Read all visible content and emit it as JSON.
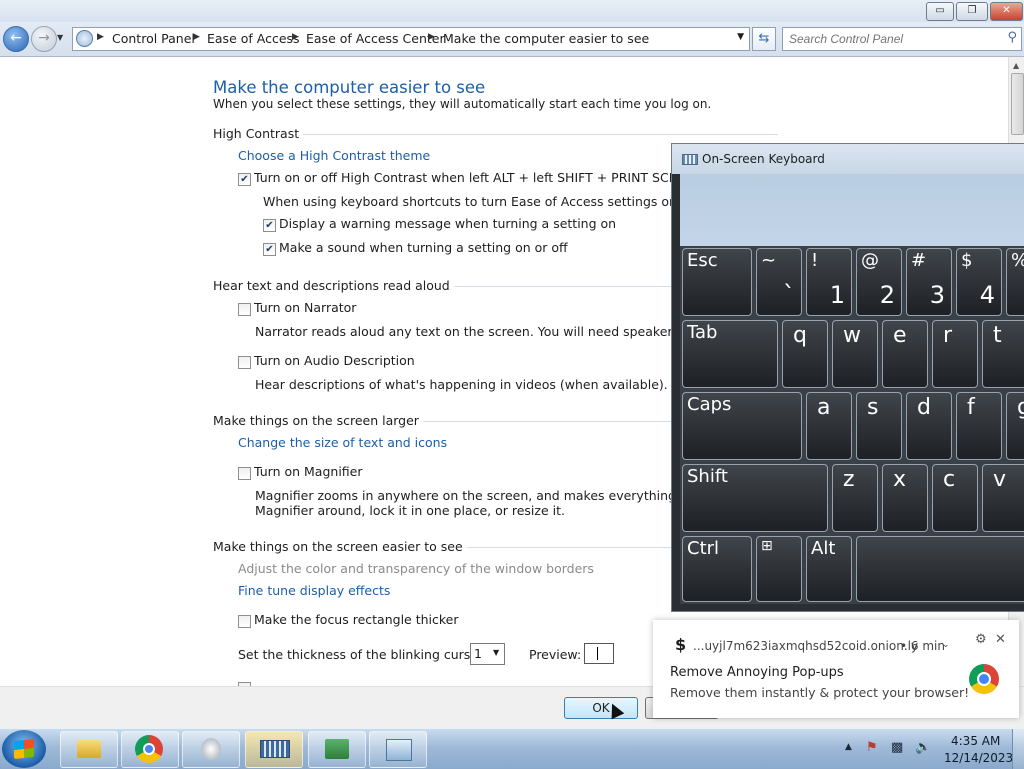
{
  "window": {
    "minimize": "▭",
    "restore": "❐",
    "close": "✕"
  },
  "address": {
    "crumbs": [
      "Control Panel",
      "Ease of Access",
      "Ease of Access Center",
      "Make the computer easier to see"
    ],
    "search_placeholder": "Search Control Panel"
  },
  "page": {
    "title": "Make the computer easier to see",
    "subtitle": "When you select these settings, they will automatically start each time you log on.",
    "high_contrast": {
      "heading": "High Contrast",
      "link": "Choose a High Contrast theme",
      "toggle_label": "Turn on or off High Contrast when left ALT + left SHIFT + PRINT SCREEN is p",
      "toggle_checked": true,
      "shortcut_note": "When using keyboard shortcuts to turn Ease of Access settings on:",
      "warning_label": "Display a warning message when turning a setting on",
      "warning_checked": true,
      "sound_label": "Make a sound when turning a setting on or off",
      "sound_checked": true
    },
    "narrator": {
      "heading": "Hear text and descriptions read aloud",
      "narrator_label": "Turn on Narrator",
      "narrator_desc": "Narrator reads aloud any text on the screen. You will need speakers.",
      "audio_label": "Turn on Audio Description",
      "audio_desc": "Hear descriptions of what's happening in videos (when available)."
    },
    "larger": {
      "heading": "Make things on the screen larger",
      "link": "Change the size of text and icons",
      "magnifier_label": "Turn on Magnifier",
      "magnifier_desc1": "Magnifier zooms in anywhere on the screen, and makes everything in that a",
      "magnifier_desc2": "Magnifier around, lock it in one place, or resize it."
    },
    "easier": {
      "heading": "Make things on the screen easier to see",
      "link_disabled": "Adjust the color and transparency of the window borders",
      "link": "Fine tune display effects",
      "focus_label": "Make the focus rectangle thicker",
      "cursor_label": "Set the thickness of the blinking cursor:",
      "cursor_value": "1",
      "preview_label": "Preview:"
    }
  },
  "footer": {
    "ok": "OK"
  },
  "osk": {
    "title": "On-Screen Keyboard",
    "row1": [
      {
        "top": "Esc",
        "bottom": ""
      },
      {
        "top": "~",
        "bottom": "`"
      },
      {
        "top": "!",
        "bottom": "1"
      },
      {
        "top": "@",
        "bottom": "2"
      },
      {
        "top": "#",
        "bottom": "3"
      },
      {
        "top": "$",
        "bottom": "4"
      },
      {
        "top": "%",
        "bottom": ""
      }
    ],
    "row2": [
      "Tab",
      "q",
      "w",
      "e",
      "r",
      "t"
    ],
    "row3": [
      "Caps",
      "a",
      "s",
      "d",
      "f",
      "g"
    ],
    "row4": [
      "Shift",
      "z",
      "x",
      "c",
      "v"
    ],
    "row5": [
      "Ctrl",
      "",
      "Alt"
    ]
  },
  "notification": {
    "source": "...uyjl7m623iaxmqhsd52coid.onion.ly",
    "time": "• 6 min",
    "title": "Remove Annoying Pop-ups",
    "body": "Remove them instantly & protect your browser!"
  },
  "taskbar": {
    "time": "4:35 AM",
    "date": "12/14/2023"
  }
}
